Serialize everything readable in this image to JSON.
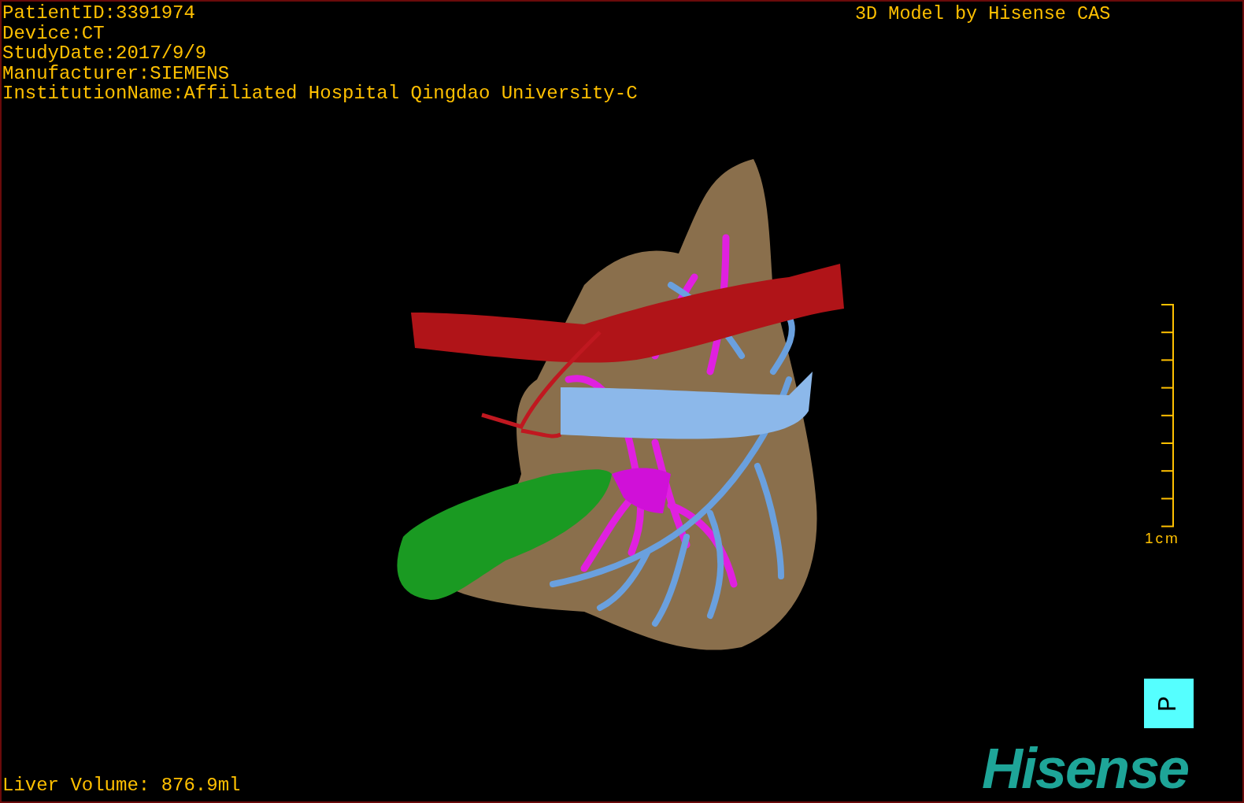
{
  "patient_info": [
    "PatientID:3391974",
    "Device:CT",
    "StudyDate:2017/9/9",
    "Manufacturer:SIEMENS",
    "InstitutionName:Affiliated Hospital Qingdao University-C"
  ],
  "title": "3D Model by Hisense CAS",
  "scale_bar": {
    "label": "1cm"
  },
  "orientation_marker": {
    "label": "P"
  },
  "liver_volume": "Liver Volume: 876.9ml",
  "logo": "Hisense"
}
